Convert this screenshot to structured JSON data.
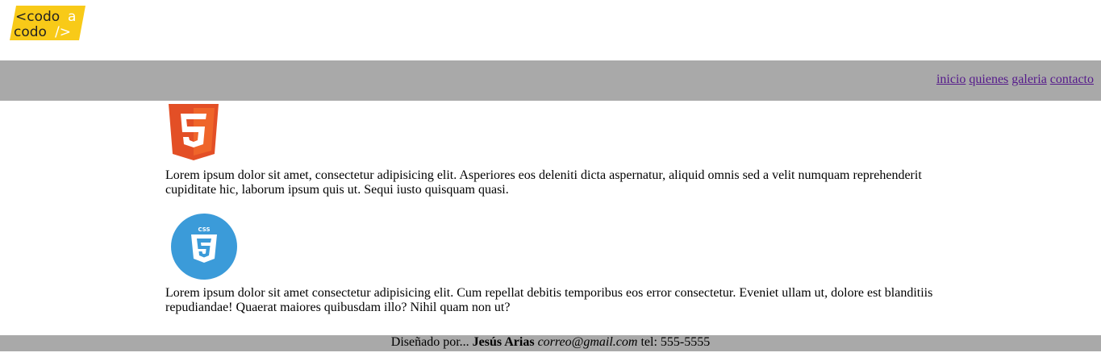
{
  "brand": {
    "logo_line1_left": "<codo",
    "logo_line1_right": "a",
    "logo_line2_left": "codo",
    "logo_line2_right": "/>",
    "logo_color": "#f8ca18"
  },
  "nav": {
    "items": [
      {
        "label": "inicio"
      },
      {
        "label": "quienes"
      },
      {
        "label": "galeria"
      },
      {
        "label": "contacto"
      }
    ],
    "background": "#a9a9a9",
    "link_color": "#551a8b"
  },
  "main": {
    "html5_icon": "html5-logo",
    "paragraph1": "Lorem ipsum dolor sit amet, consectetur adipisicing elit. Asperiores eos deleniti dicta aspernatur, aliquid omnis sed a velit numquam reprehenderit cupiditate hic, laborum ipsum quis ut. Sequi iusto quisquam quasi.",
    "css3_icon": "css3-logo",
    "css3_badge_text": "CSS",
    "paragraph2": "Lorem ipsum dolor sit amet consectetur adipisicing elit. Cum repellat debitis temporibus eos error consectetur. Eveniet ullam ut, dolore est blanditiis repudiandae! Quaerat maiores quibusdam illo? Nihil quam non ut?"
  },
  "footer": {
    "prefix": "Diseñado por... ",
    "author": "Jesús Arias",
    "email": "correo@gmail.com",
    "phone": " tel: 555-5555"
  }
}
